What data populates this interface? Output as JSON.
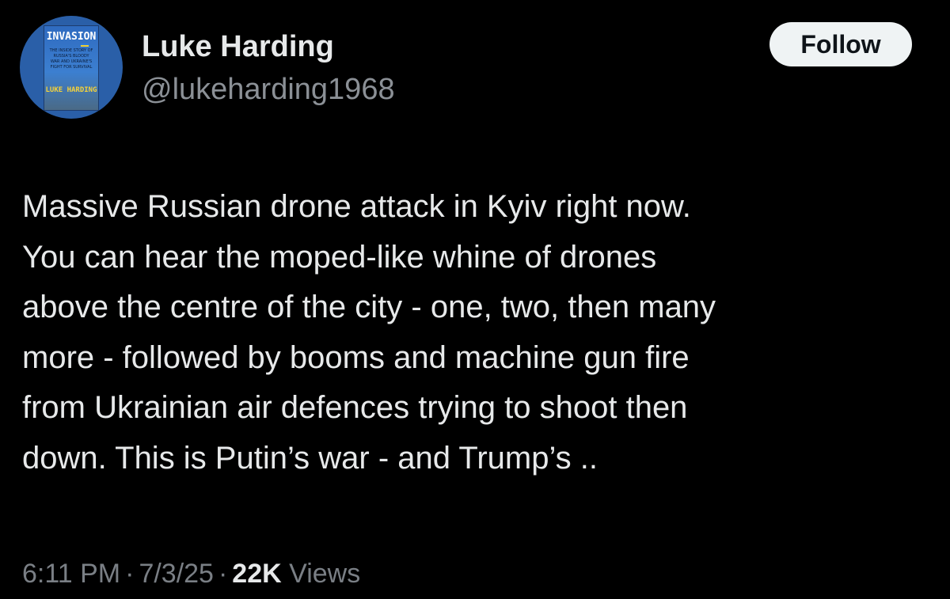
{
  "author": {
    "display_name": "Luke Harding",
    "handle": "@lukeharding1968",
    "avatar": {
      "book_title": "INVASION",
      "book_subtitle": "The inside story of Russia's bloody war and Ukraine's fight for survival",
      "book_author": "LUKE HARDING",
      "colors": {
        "background": "#2a5fa8",
        "title": "#ffffff",
        "author": "#f5d23a"
      }
    }
  },
  "actions": {
    "follow_label": "Follow"
  },
  "tweet": {
    "text": "Massive Russian drone attack in Kyiv right now.\nYou can hear the moped-like whine of drones\nabove the centre of the city - one, two, then many\nmore - followed by booms and machine gun fire\nfrom Ukrainian air defences trying to shoot then\ndown. This is Putin’s war - and Trump’s .."
  },
  "meta": {
    "time": "6:11 PM",
    "date": "7/3/25",
    "separator": "·",
    "views_count": "22K",
    "views_label": "Views"
  },
  "theme": {
    "background": "#000000",
    "primary_text": "#e7e9ea",
    "secondary_text": "#8b9096",
    "button_bg": "#eff3f4",
    "button_text": "#0f1419"
  }
}
